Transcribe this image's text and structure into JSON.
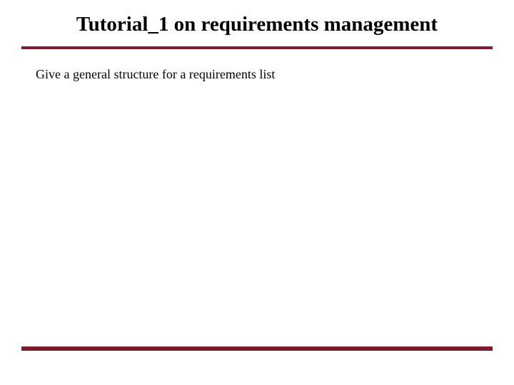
{
  "slide": {
    "title": "Tutorial_1 on requirements management",
    "body": "Give a general structure for a requirements list"
  },
  "colors": {
    "accent": "#7a1d2e"
  }
}
